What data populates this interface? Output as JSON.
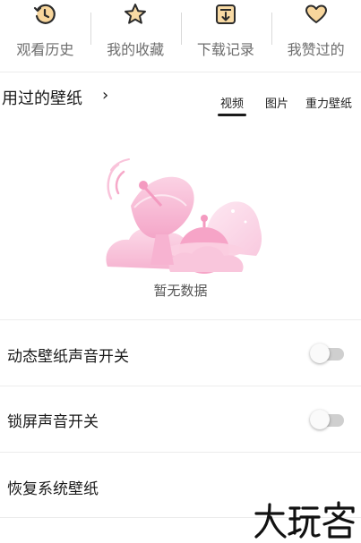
{
  "top_nav": [
    {
      "label": "观看历史",
      "icon": "history-clock-icon"
    },
    {
      "label": "我的收藏",
      "icon": "star-icon"
    },
    {
      "label": "下载记录",
      "icon": "download-box-icon"
    },
    {
      "label": "我赞过的",
      "icon": "heart-icon"
    }
  ],
  "used_wallpapers": {
    "title": "用过的壁纸",
    "arrow": "›",
    "tabs": [
      {
        "label": "视频",
        "active": true
      },
      {
        "label": "图片",
        "active": false
      },
      {
        "label": "重力壁纸",
        "active": false
      }
    ],
    "empty_text": "暂无数据"
  },
  "settings": [
    {
      "label": "动态壁纸声音开关",
      "toggle": true,
      "on": false
    },
    {
      "label": "锁屏声音开关",
      "toggle": true,
      "on": false
    },
    {
      "label": "恢复系统壁纸",
      "toggle": false
    }
  ],
  "watermark": {
    "text": "大玩客"
  },
  "colors": {
    "icon_dark": "#2b2b2b",
    "icon_gold": "#f2b54a",
    "illustration_pink": "#f7b7d2",
    "toggle_track": "#cfcfcf"
  }
}
